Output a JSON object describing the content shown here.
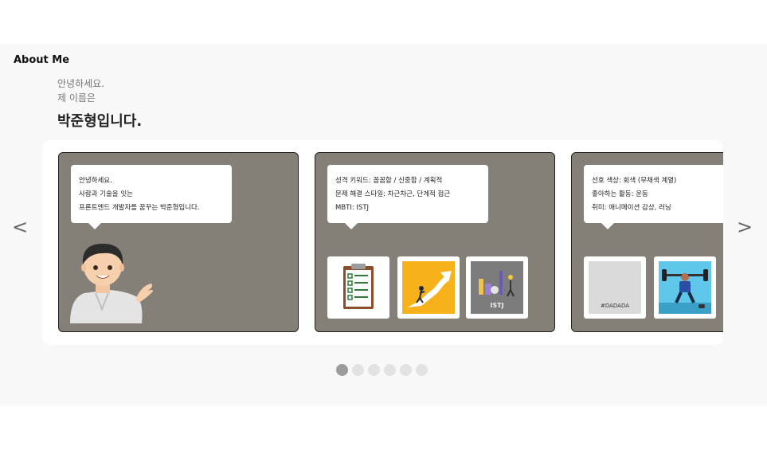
{
  "about": {
    "title": "About Me",
    "greeting_line1": "안녕하세요.",
    "greeting_line2": "제 이름은",
    "name": "박준형입니다."
  },
  "carousel": {
    "prev_arrow": "<",
    "next_arrow": ">",
    "cards": [
      {
        "lines": [
          "안녕하세요.",
          "사람과 기술을 잇는",
          "프론트엔드 개발자를 꿈꾸는 박준형입니다."
        ]
      },
      {
        "lines": [
          "성격 키워드: 꼼꼼함 / 신중함 / 계획적",
          "문제 해결 스타일: 차근차근, 단계적 접근",
          "MBTI: ISTJ"
        ],
        "thumb_text": "ISTJ"
      },
      {
        "lines": [
          "선호 색상: 회색 (무채색 계열)",
          "좋아하는 활동: 운동",
          "취미: 애니메이션 감상, 러닝"
        ],
        "swatch_label": "#DADADA"
      }
    ]
  },
  "pagination": {
    "count": 6,
    "active_index": 0
  },
  "colors": {
    "card_bg": "#847f77",
    "swatch": "#DADADA",
    "section_bg": "#f8f8f8"
  }
}
